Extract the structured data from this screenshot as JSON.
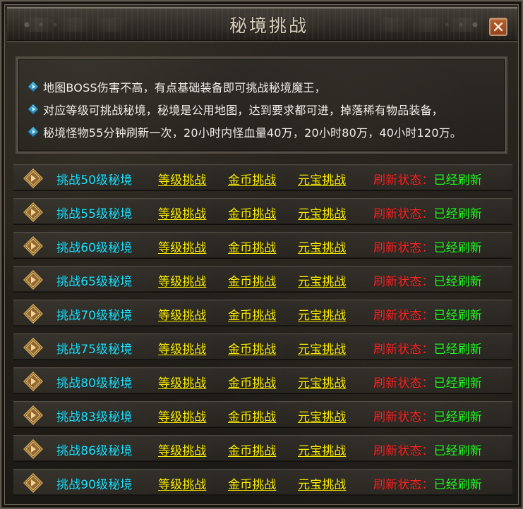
{
  "window": {
    "title": "秘境挑战",
    "close_icon": "close-icon"
  },
  "info": {
    "lines": [
      "地图BOSS伤害不高，有点基础装备即可挑战秘境魔王，",
      "对应等级可挑战秘境，秘境是公用地图，达到要求都可进，掉落稀有物品装备，",
      "秘境怪物55分钟刷新一次，20小时内怪血量40万，20小时80万，40小时120万。"
    ]
  },
  "rows": [
    {
      "title": "挑战50级秘境",
      "level": "等级挑战",
      "gold": "金币挑战",
      "ingot": "元宝挑战",
      "status_label": "刷新状态：",
      "status_value": "已经刷新"
    },
    {
      "title": "挑战55级秘境",
      "level": "等级挑战",
      "gold": "金币挑战",
      "ingot": "元宝挑战",
      "status_label": "刷新状态：",
      "status_value": "已经刷新"
    },
    {
      "title": "挑战60级秘境",
      "level": "等级挑战",
      "gold": "金币挑战",
      "ingot": "元宝挑战",
      "status_label": "刷新状态：",
      "status_value": "已经刷新"
    },
    {
      "title": "挑战65级秘境",
      "level": "等级挑战",
      "gold": "金币挑战",
      "ingot": "元宝挑战",
      "status_label": "刷新状态：",
      "status_value": "已经刷新"
    },
    {
      "title": "挑战70级秘境",
      "level": "等级挑战",
      "gold": "金币挑战",
      "ingot": "元宝挑战",
      "status_label": "刷新状态：",
      "status_value": "已经刷新"
    },
    {
      "title": "挑战75级秘境",
      "level": "等级挑战",
      "gold": "金币挑战",
      "ingot": "元宝挑战",
      "status_label": "刷新状态：",
      "status_value": "已经刷新"
    },
    {
      "title": "挑战80级秘境",
      "level": "等级挑战",
      "gold": "金币挑战",
      "ingot": "元宝挑战",
      "status_label": "刷新状态：",
      "status_value": "已经刷新"
    },
    {
      "title": "挑战83级秘境",
      "level": "等级挑战",
      "gold": "金币挑战",
      "ingot": "元宝挑战",
      "status_label": "刷新状态：",
      "status_value": "已经刷新"
    },
    {
      "title": "挑战86级秘境",
      "level": "等级挑战",
      "gold": "金币挑战",
      "ingot": "元宝挑战",
      "status_label": "刷新状态：",
      "status_value": "已经刷新"
    },
    {
      "title": "挑战90级秘境",
      "level": "等级挑战",
      "gold": "金币挑战",
      "ingot": "元宝挑战",
      "status_label": "刷新状态：",
      "status_value": "已经刷新"
    }
  ],
  "colors": {
    "title_text": "#d9cfbe",
    "info_text": "#f1eee9",
    "row_title": "#21e3ff",
    "row_action": "#fff200",
    "status_label": "#ff2626",
    "status_value": "#26ff26",
    "close_button": "#a24d21"
  },
  "icons": {
    "info_bullet": "blue-diamond-arrow-icon",
    "row_icon": "gold-diamond-arrow-icon"
  }
}
